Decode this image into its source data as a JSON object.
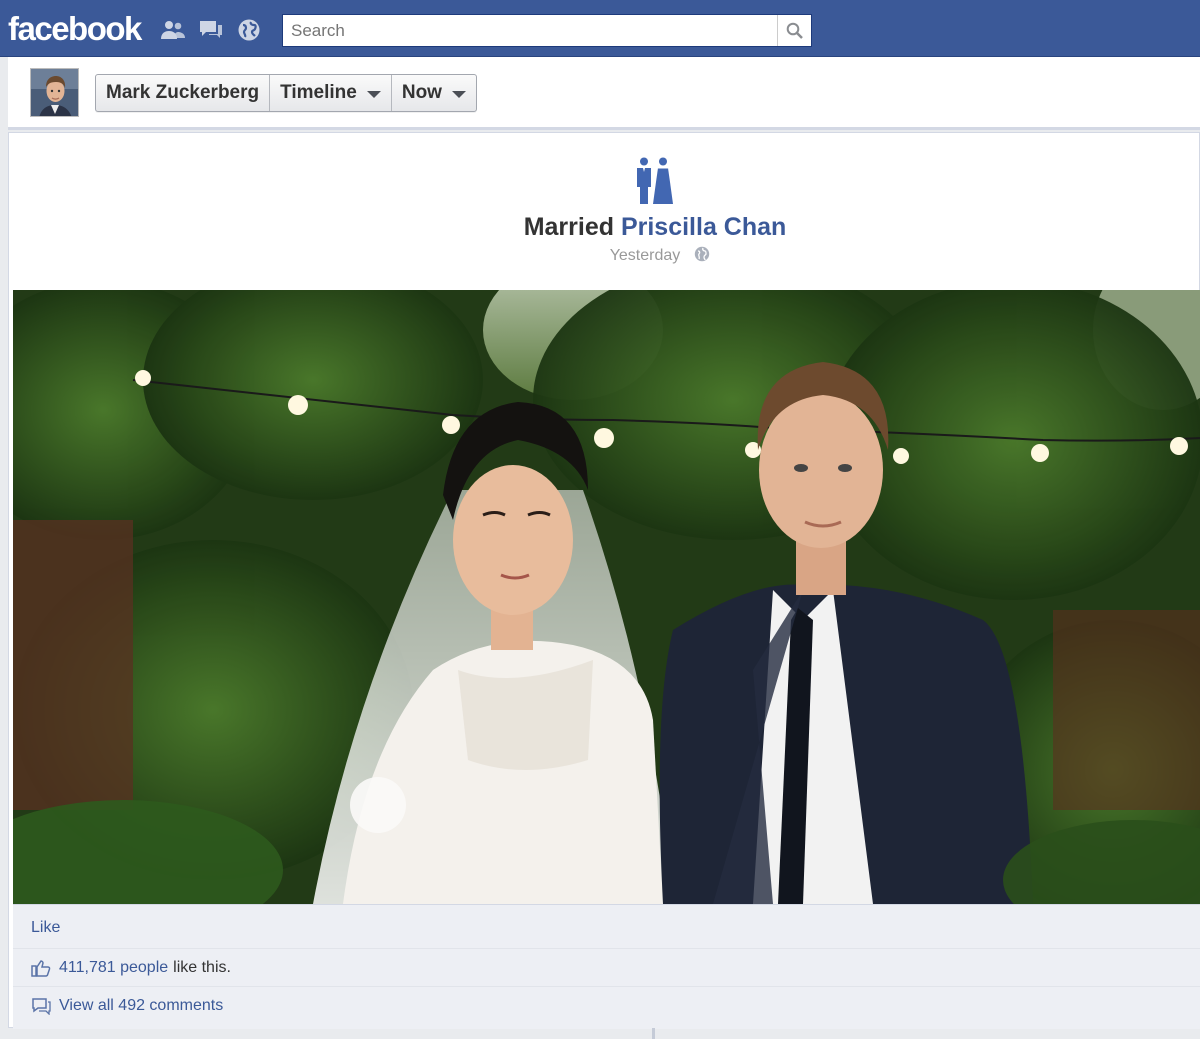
{
  "header": {
    "logo": "facebook",
    "search_placeholder": "Search",
    "jewels": [
      "friend-requests-icon",
      "messages-icon",
      "notifications-icon"
    ],
    "brand_color": "#3b5998"
  },
  "timeline_nav": {
    "profile_name": "Mark Zuckerberg",
    "section": "Timeline",
    "period": "Now"
  },
  "life_event": {
    "icon": "wedding-couple-icon",
    "verb": "Married",
    "partner": "Priscilla Chan",
    "time": "Yesterday",
    "audience_icon": "globe-icon"
  },
  "photo": {
    "description_icon": "wedding-photo"
  },
  "ufi": {
    "like_label": "Like",
    "likes_count": "411,781 people",
    "likes_suffix": "like this.",
    "comments_label": "View all 492 comments"
  }
}
